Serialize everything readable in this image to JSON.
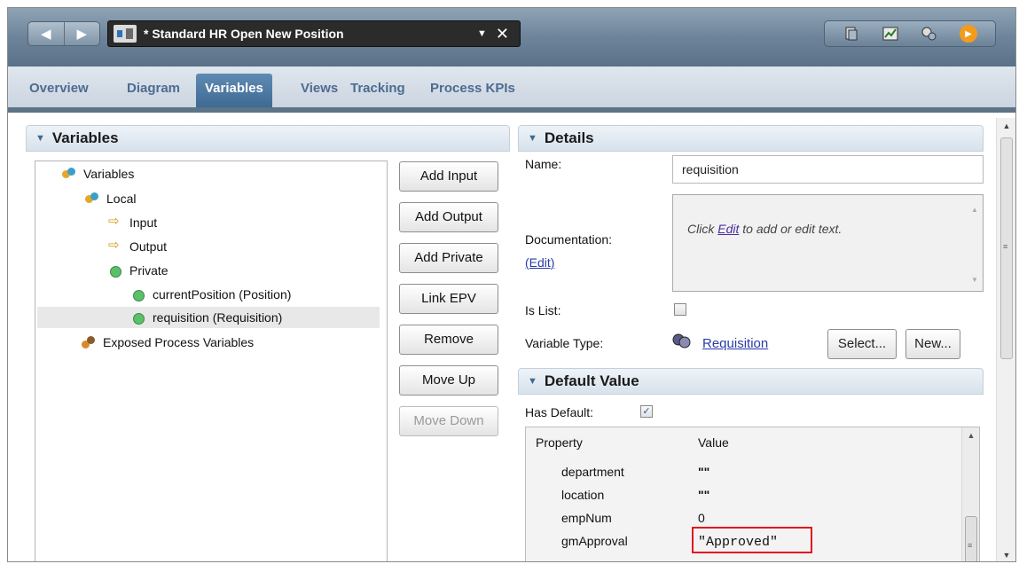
{
  "titlebar": {
    "doc_title": "* Standard HR Open New Position",
    "back_glyph": "◀",
    "forward_glyph": "▶",
    "dropdown_glyph": "▼",
    "close_glyph": "✕"
  },
  "tabs": [
    {
      "label": "Overview"
    },
    {
      "label": "Diagram"
    },
    {
      "label": "Variables"
    },
    {
      "label": "Views"
    },
    {
      "label": "Tracking"
    },
    {
      "label": "Process KPIs"
    }
  ],
  "variables_section": {
    "title": "Variables",
    "tree": {
      "root": "Variables",
      "local": "Local",
      "input": "Input",
      "output": "Output",
      "private": "Private",
      "private_items": [
        "currentPosition (Position)",
        "requisition (Requisition)"
      ],
      "exposed": "Exposed Process Variables"
    },
    "buttons": {
      "add_input": "Add Input",
      "add_output": "Add Output",
      "add_private": "Add Private",
      "link_epv": "Link EPV",
      "remove": "Remove",
      "move_up": "Move Up",
      "move_down": "Move Down"
    }
  },
  "details_section": {
    "title": "Details",
    "name_label": "Name:",
    "name_value": "requisition",
    "documentation_label": "Documentation:",
    "edit_link": "(Edit)",
    "doc_hint_pre": "Click ",
    "doc_hint_link": "Edit",
    "doc_hint_post": " to add or edit text.",
    "is_list_label": "Is List:",
    "is_list_checked": false,
    "variable_type_label": "Variable Type:",
    "variable_type_value": "Requisition",
    "select_button": "Select...",
    "new_button": "New..."
  },
  "default_value_section": {
    "title": "Default Value",
    "has_default_label": "Has Default:",
    "has_default_checked": true,
    "check_glyph": "✓",
    "columns": [
      "Property",
      "Value"
    ],
    "rows": [
      {
        "property": "department",
        "value": "\"\""
      },
      {
        "property": "location",
        "value": "\"\""
      },
      {
        "property": "empNum",
        "value": "0"
      },
      {
        "property": "gmApproval",
        "value": "\"Approved\""
      }
    ]
  },
  "colors": {
    "active_tab": "#4a77a2",
    "highlight_box": "#e0141e",
    "link": "#2a3aa8"
  }
}
